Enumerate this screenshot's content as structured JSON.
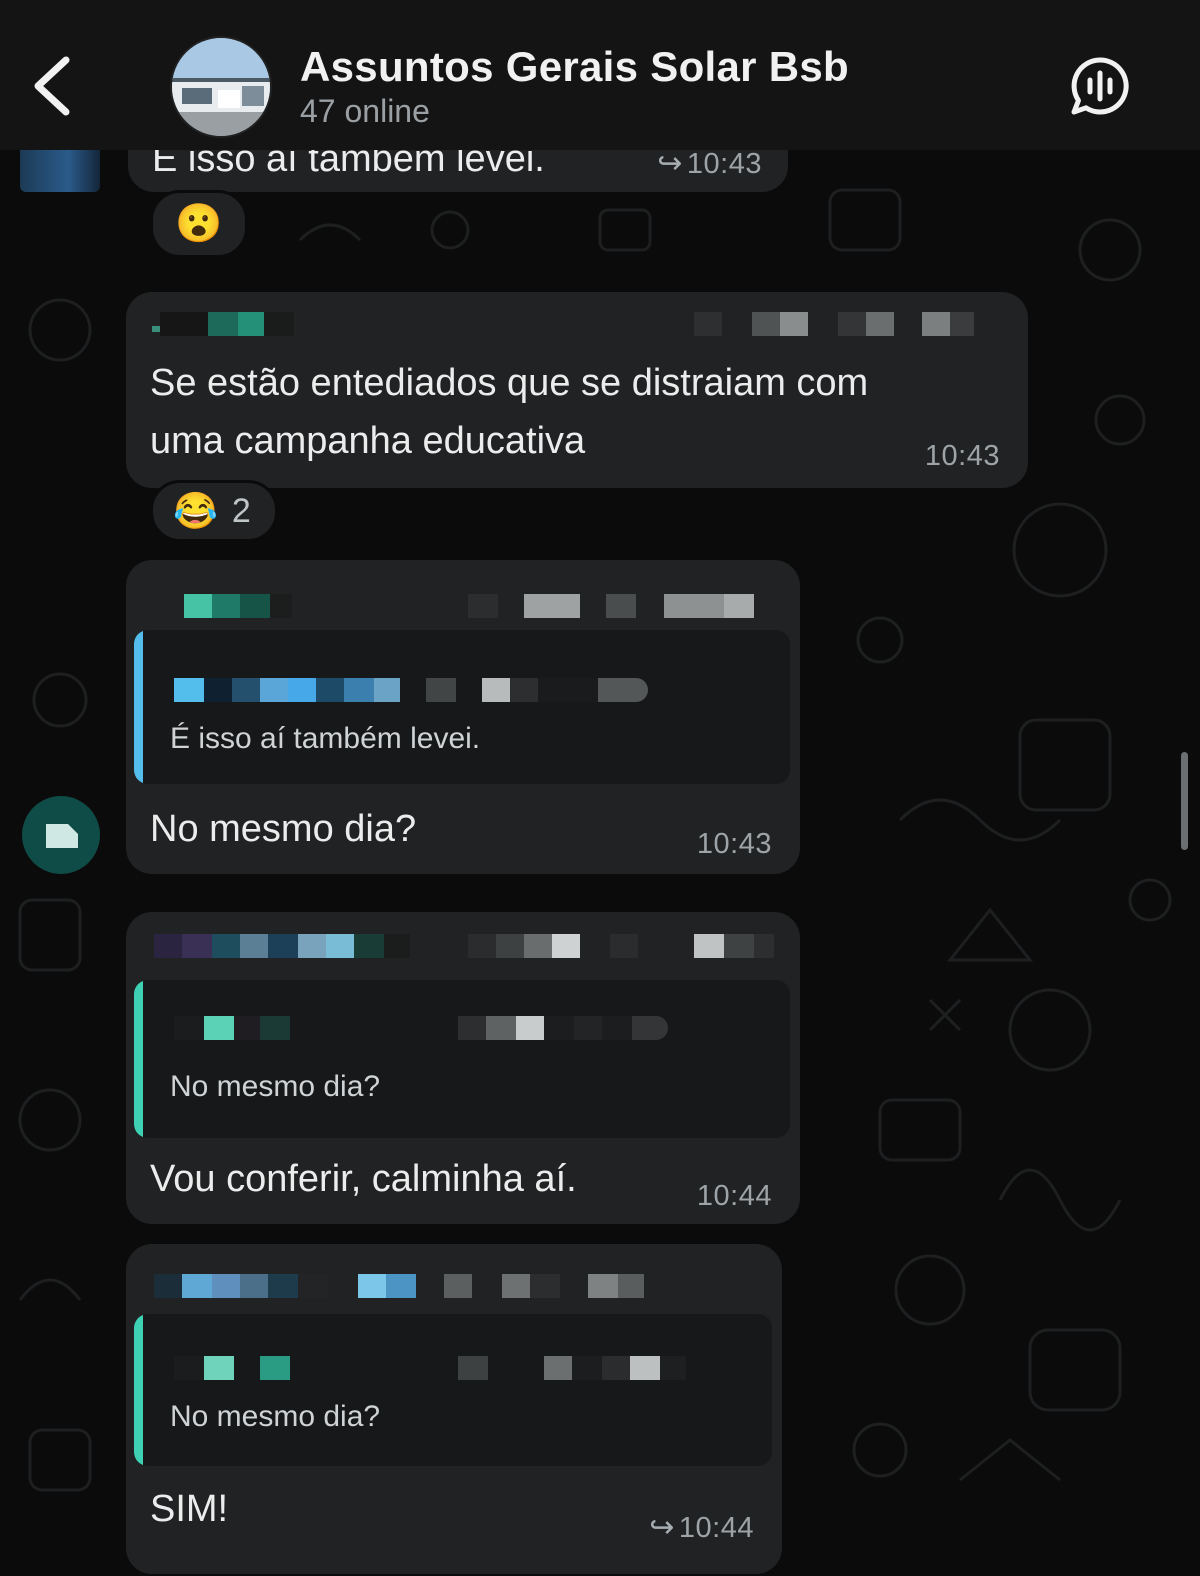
{
  "header": {
    "title": "Assuntos Gerais Solar Bsb",
    "subtitle": "47 online",
    "back_icon": "chevron-left-icon",
    "call_icon": "voice-chat-icon"
  },
  "colors": {
    "background": "#0b0b0b",
    "bubble": "#202223",
    "quote_bg": "#171819",
    "quote_bar_blue": "#53bdeb",
    "quote_bar_green": "#3fd1b4",
    "time": "#9da3a6"
  },
  "messages": [
    {
      "text": "É isso aí também levei.",
      "time": "10:43",
      "forwarded": true,
      "reaction": {
        "emoji": "😮",
        "count": ""
      }
    },
    {
      "text_line1": "Se estão entediados que se distraiam com",
      "text_line2": "uma campanha educativa",
      "time": "10:43",
      "reaction": {
        "emoji": "😂",
        "count": "2"
      }
    },
    {
      "quote": "É isso aí também levei.",
      "text": "No mesmo dia?",
      "time": "10:43"
    },
    {
      "quote": "No mesmo dia?",
      "text": "Vou conferir, calminha aí.",
      "time": "10:44"
    },
    {
      "quote": "No mesmo dia?",
      "text": "SIM!",
      "time": "10:44",
      "forwarded": true
    }
  ]
}
